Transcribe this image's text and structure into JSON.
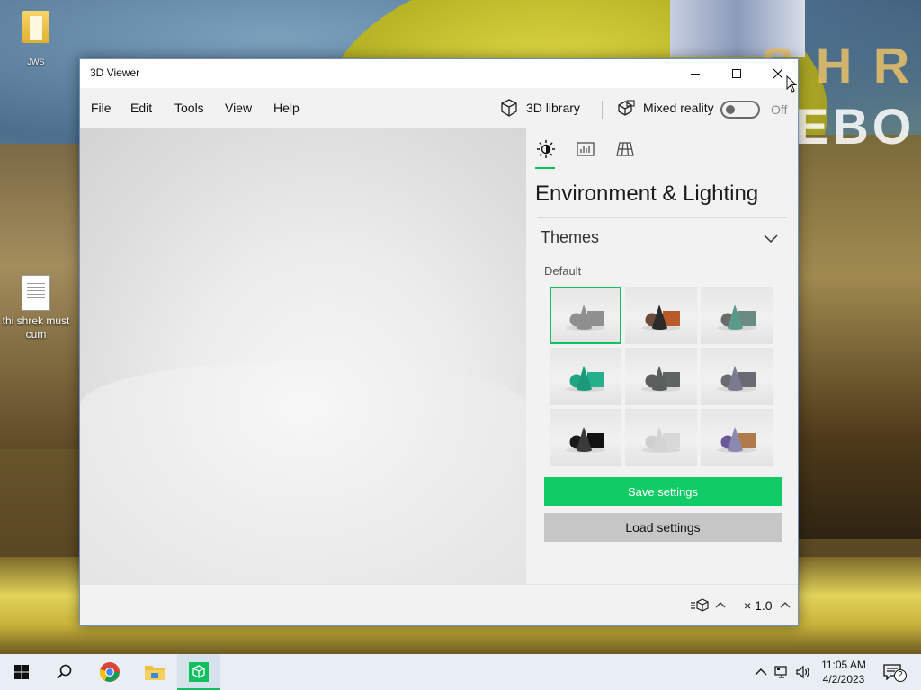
{
  "desktop": {
    "icons": [
      {
        "label": "JWS"
      },
      {
        "label": "thi shrek must cum"
      }
    ],
    "wallpaper_text_line1": "S H R",
    "wallpaper_text_line2": "EBO"
  },
  "window": {
    "title": "3D Viewer",
    "controls": {
      "minimize": "minimize-icon",
      "maximize": "maximize-icon",
      "close": "close-icon"
    }
  },
  "menu": {
    "items": [
      "File",
      "Edit",
      "Tools",
      "View",
      "Help"
    ],
    "library_label": "3D library",
    "mixed_reality_label": "Mixed reality",
    "mixed_reality_state": "Off"
  },
  "panel": {
    "tabs": [
      {
        "icon": "brightness-icon",
        "selected": true
      },
      {
        "icon": "stats-chart-icon",
        "selected": false
      },
      {
        "icon": "grid-icon",
        "selected": false
      }
    ],
    "title": "Environment & Lighting",
    "themes_header": "Themes",
    "themes_group_label": "Default",
    "themes": [
      {
        "id": 1,
        "selected": true,
        "cone": "#8f8f8f",
        "ball": "#8f8f8f",
        "box": "#8f8f8f"
      },
      {
        "id": 2,
        "selected": false,
        "cone": "#2a2a2a",
        "ball": "#6d4a3a",
        "box": "#b85a2a"
      },
      {
        "id": 3,
        "selected": false,
        "cone": "#5a9a8a",
        "ball": "#6a6a6a",
        "box": "#6a8a84"
      },
      {
        "id": 4,
        "selected": false,
        "cone": "#1a9a7a",
        "ball": "#20a484",
        "box": "#24b08a"
      },
      {
        "id": 5,
        "selected": false,
        "cone": "#5a5e5c",
        "ball": "#5a5e5c",
        "box": "#5e6462"
      },
      {
        "id": 6,
        "selected": false,
        "cone": "#7a7a90",
        "ball": "#6a6a70",
        "box": "#6a6a74"
      },
      {
        "id": 7,
        "selected": false,
        "cone": "#3a3a3a",
        "ball": "#1a1a1a",
        "box": "#121212"
      },
      {
        "id": 8,
        "selected": false,
        "cone": "#d4d4d4",
        "ball": "#cfcfcf",
        "box": "#d8d8d8"
      },
      {
        "id": 9,
        "selected": false,
        "cone": "#8a8ab0",
        "ball": "#6a5a9a",
        "box": "#b07a4a"
      }
    ],
    "save_label": "Save settings",
    "load_label": "Load settings"
  },
  "status": {
    "scale_label": "× 1.0"
  },
  "taskbar": {
    "clock_time": "11:05 AM",
    "clock_date": "4/2/2023",
    "notification_count": "2"
  },
  "colors": {
    "accent": "#10c060",
    "save_button": "#11cc66",
    "load_button": "#c6c6c6"
  }
}
